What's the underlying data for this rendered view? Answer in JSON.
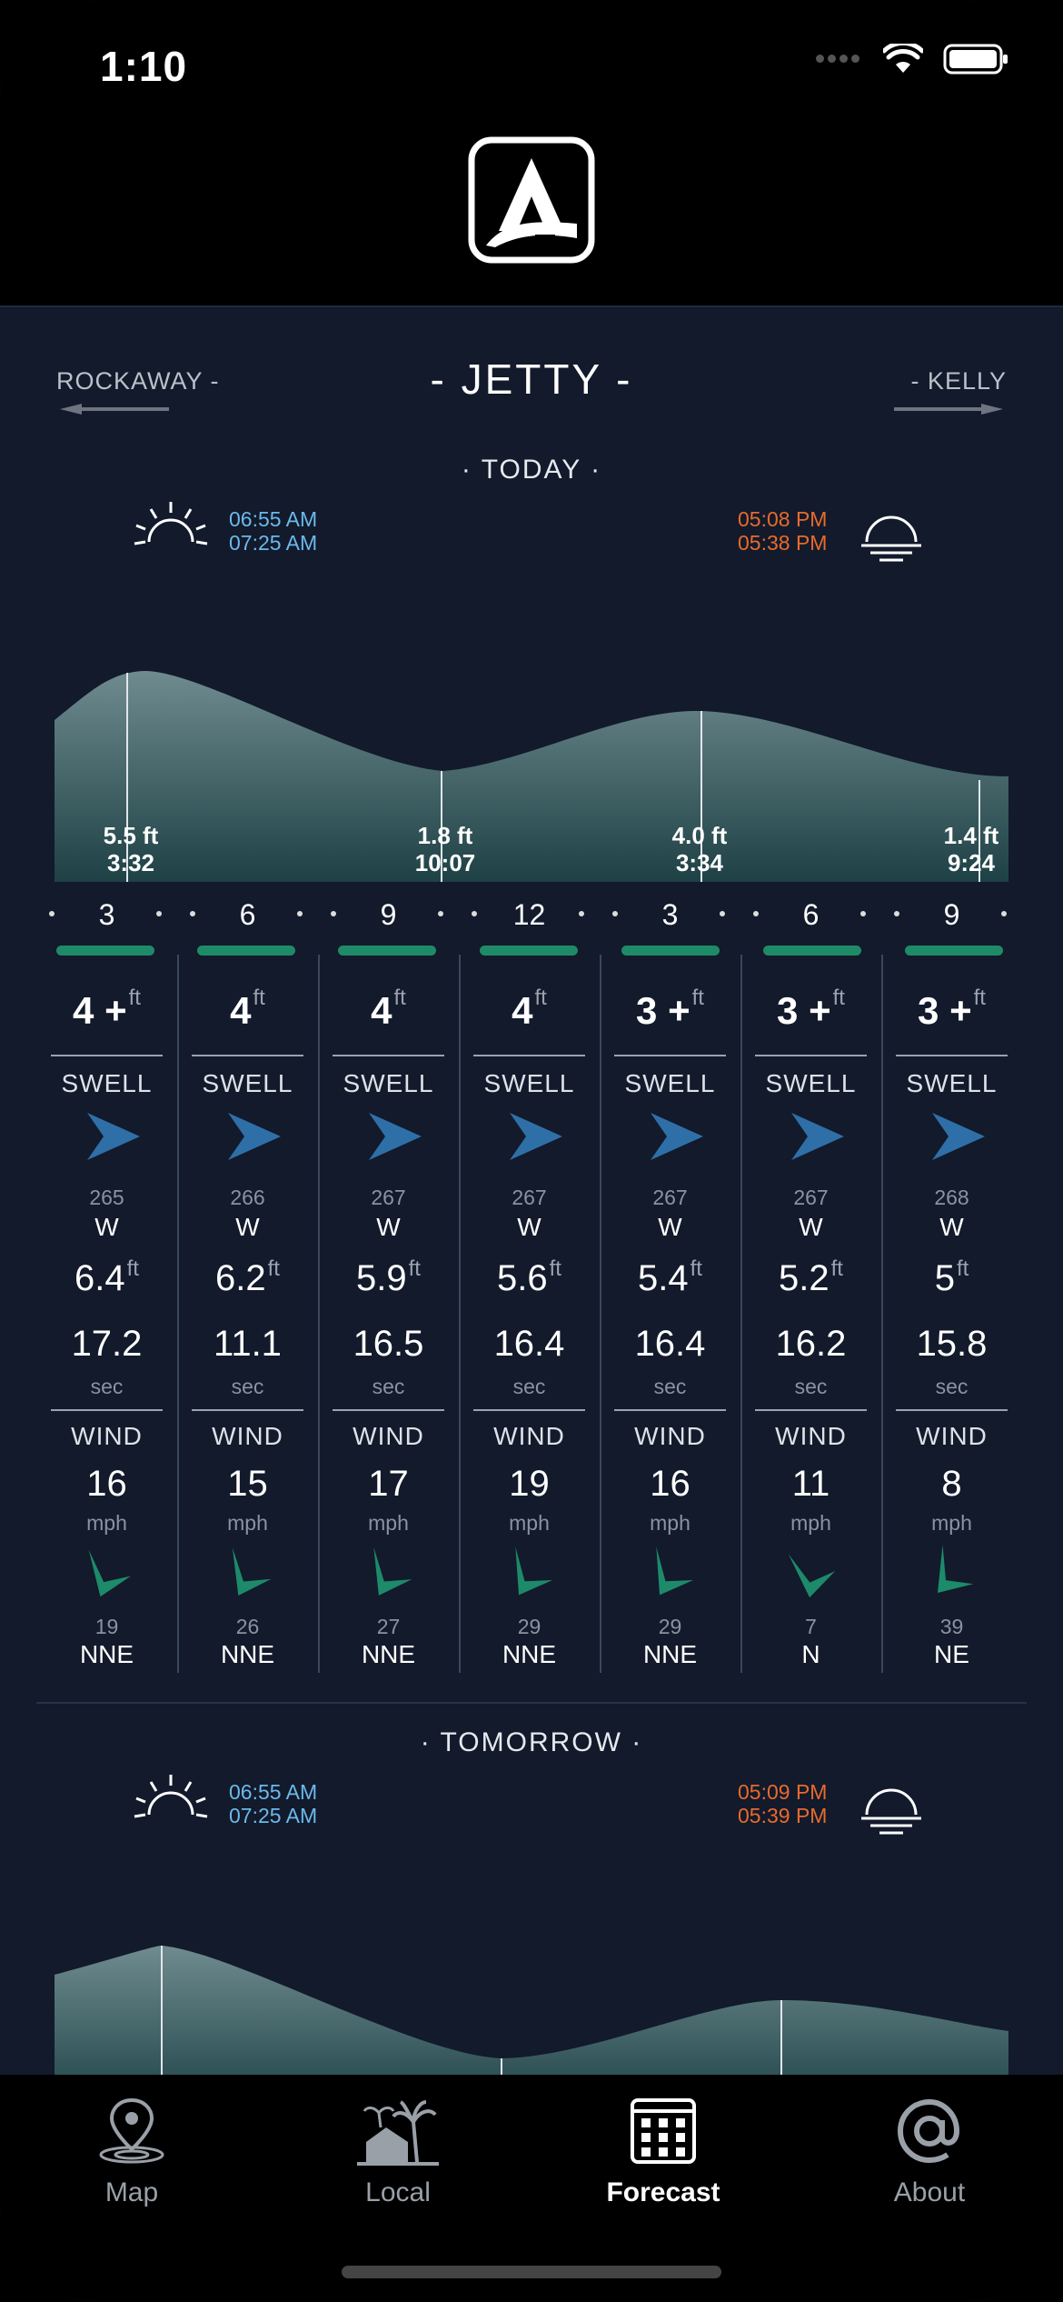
{
  "status_bar": {
    "time": "1:10"
  },
  "nav": {
    "prev_spot": "ROCKAWAY -",
    "current_spot": "- JETTY -",
    "next_spot": "- KELLY"
  },
  "today": {
    "label": "· TODAY ·",
    "sunrise": [
      "06:55 AM",
      "07:25 AM"
    ],
    "sunset": [
      "05:08 PM",
      "05:38 PM"
    ],
    "tides": [
      {
        "height": "5.5 ft",
        "time": "3:32"
      },
      {
        "height": "1.8 ft",
        "time": "10:07"
      },
      {
        "height": "4.0 ft",
        "time": "3:34"
      },
      {
        "height": "1.4 ft",
        "time": "9:24"
      }
    ],
    "hours": [
      "3",
      "6",
      "9",
      "12",
      "3",
      "6",
      "9"
    ],
    "forecast": [
      {
        "wave": "4 +",
        "wave_unit": "ft",
        "swell_label": "SWELL",
        "swell_deg": "265",
        "swell_dir": "W",
        "swell_height": "6.4",
        "swell_unit": "ft",
        "period": "17.2",
        "period_unit": "sec",
        "wind_label": "WIND",
        "wind_speed": "16",
        "wind_unit": "mph",
        "wind_deg": "19",
        "wind_dir": "NNE"
      },
      {
        "wave": "4",
        "wave_unit": "ft",
        "swell_label": "SWELL",
        "swell_deg": "266",
        "swell_dir": "W",
        "swell_height": "6.2",
        "swell_unit": "ft",
        "period": "11.1",
        "period_unit": "sec",
        "wind_label": "WIND",
        "wind_speed": "15",
        "wind_unit": "mph",
        "wind_deg": "26",
        "wind_dir": "NNE"
      },
      {
        "wave": "4",
        "wave_unit": "ft",
        "swell_label": "SWELL",
        "swell_deg": "267",
        "swell_dir": "W",
        "swell_height": "5.9",
        "swell_unit": "ft",
        "period": "16.5",
        "period_unit": "sec",
        "wind_label": "WIND",
        "wind_speed": "17",
        "wind_unit": "mph",
        "wind_deg": "27",
        "wind_dir": "NNE"
      },
      {
        "wave": "4",
        "wave_unit": "ft",
        "swell_label": "SWELL",
        "swell_deg": "267",
        "swell_dir": "W",
        "swell_height": "5.6",
        "swell_unit": "ft",
        "period": "16.4",
        "period_unit": "sec",
        "wind_label": "WIND",
        "wind_speed": "19",
        "wind_unit": "mph",
        "wind_deg": "29",
        "wind_dir": "NNE"
      },
      {
        "wave": "3 +",
        "wave_unit": "ft",
        "swell_label": "SWELL",
        "swell_deg": "267",
        "swell_dir": "W",
        "swell_height": "5.4",
        "swell_unit": "ft",
        "period": "16.4",
        "period_unit": "sec",
        "wind_label": "WIND",
        "wind_speed": "16",
        "wind_unit": "mph",
        "wind_deg": "29",
        "wind_dir": "NNE"
      },
      {
        "wave": "3 +",
        "wave_unit": "ft",
        "swell_label": "SWELL",
        "swell_deg": "267",
        "swell_dir": "W",
        "swell_height": "5.2",
        "swell_unit": "ft",
        "period": "16.2",
        "period_unit": "sec",
        "wind_label": "WIND",
        "wind_speed": "11",
        "wind_unit": "mph",
        "wind_deg": "7",
        "wind_dir": "N"
      },
      {
        "wave": "3 +",
        "wave_unit": "ft",
        "swell_label": "SWELL",
        "swell_deg": "268",
        "swell_dir": "W",
        "swell_height": "5",
        "swell_unit": "ft",
        "period": "15.8",
        "period_unit": "sec",
        "wind_label": "WIND",
        "wind_speed": "8",
        "wind_unit": "mph",
        "wind_deg": "39",
        "wind_dir": "NE"
      }
    ]
  },
  "tomorrow": {
    "label": "· TOMORROW ·",
    "sunrise": [
      "06:55 AM",
      "07:25 AM"
    ],
    "sunset": [
      "05:09 PM",
      "05:39 PM"
    ]
  },
  "tabs": [
    {
      "label": "Map",
      "icon": "map-pin-icon"
    },
    {
      "label": "Local",
      "icon": "palm-island-icon"
    },
    {
      "label": "Forecast",
      "icon": "calendar-grid-icon"
    },
    {
      "label": "About",
      "icon": "at-sign-icon"
    }
  ],
  "active_tab": "Forecast",
  "colors": {
    "background": "#121a2b",
    "sunrise": "#6bb9ec",
    "sunset": "#e86a2c",
    "condition_bar": "#1f8a67",
    "swell_arrow": "#2f6fa8",
    "wind_arrow": "#1d8a6a"
  }
}
